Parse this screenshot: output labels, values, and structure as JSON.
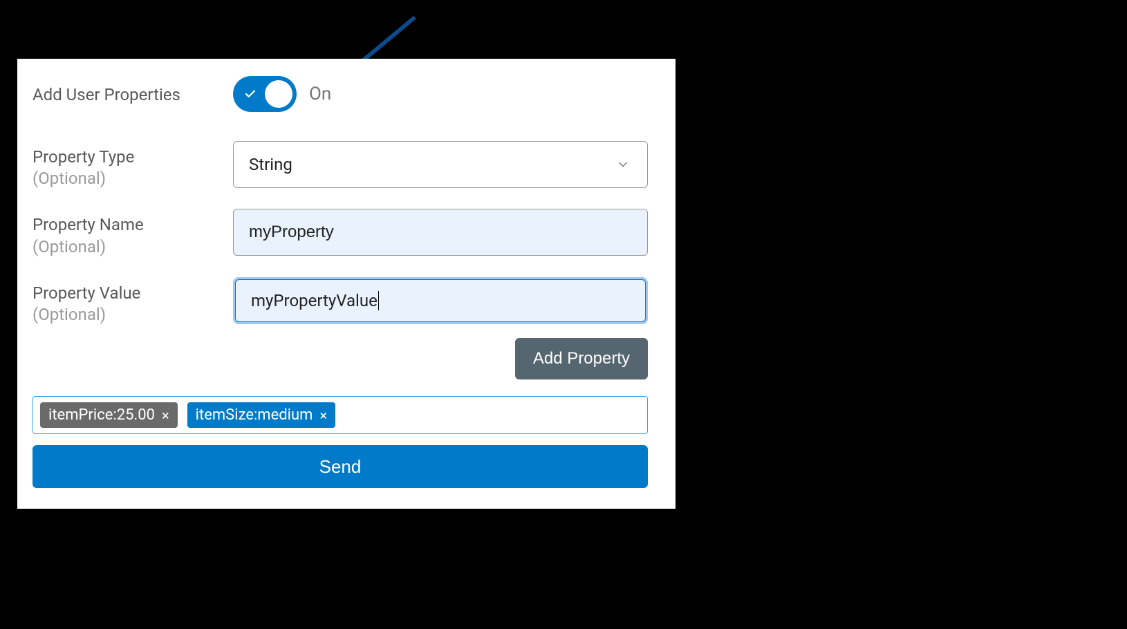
{
  "toggle": {
    "label": "Add User Properties",
    "state": "On"
  },
  "propertyType": {
    "label": "Property Type",
    "sub": "(Optional)",
    "value": "String"
  },
  "propertyName": {
    "label": "Property Name",
    "sub": "(Optional)",
    "value": "myProperty"
  },
  "propertyValue": {
    "label": "Property Value",
    "sub": "(Optional)",
    "value": "myPropertyValue"
  },
  "addPropertyButton": "Add Property",
  "chips": [
    {
      "text": "itemPrice:25.00",
      "variant": "gray"
    },
    {
      "text": "itemSize:medium",
      "variant": "blue"
    }
  ],
  "sendButton": "Send",
  "colors": {
    "accent": "#007ac9",
    "secondary": "#566671",
    "inputBg": "#e9f2fd",
    "focusRing": "#9cc8f2"
  }
}
